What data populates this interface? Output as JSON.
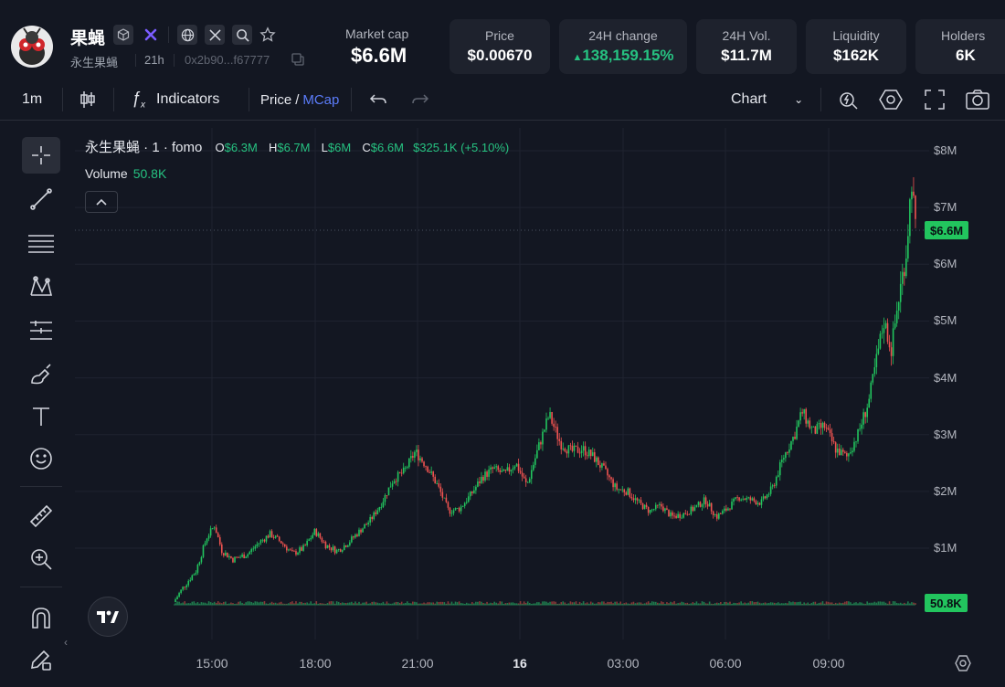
{
  "header": {
    "name": "果蝇",
    "subtitle": "永生果蝇",
    "age": "21h",
    "address": "0x2b90...f67777",
    "market_cap": {
      "label": "Market cap",
      "value": "$6.6M"
    },
    "stats": [
      {
        "label": "Price",
        "value": "$0.00670"
      },
      {
        "label": "24H change",
        "value": "138,159.15%",
        "color": "#26c281"
      },
      {
        "label": "24H Vol.",
        "value": "$11.7M"
      },
      {
        "label": "Liquidity",
        "value": "$162K"
      },
      {
        "label": "Holders",
        "value": "6K"
      }
    ]
  },
  "toolbar": {
    "interval": "1m",
    "indicators": "Indicators",
    "price": "Price",
    "slash": "/",
    "mcap": "MCap",
    "chart": "Chart"
  },
  "legend": {
    "title": "永生果蝇 · 1 · fomo",
    "o_key": "O",
    "o": "$6.3M",
    "h_key": "H",
    "h": "$6.7M",
    "l_key": "L",
    "l": "$6M",
    "c_key": "C",
    "c": "$6.6M",
    "change": "$325.1K (+5.10%)",
    "volume_label": "Volume",
    "volume": "50.8K"
  },
  "colors": {
    "up": "#26a69a",
    "up_bright": "#22c55e",
    "down": "#ef5350",
    "accent": "#5b7cfa"
  },
  "chart_data": {
    "type": "candlestick",
    "y_ticks": [
      "$8M",
      "$7M",
      "$6M",
      "$5M",
      "$4M",
      "$3M",
      "$2M",
      "$1M"
    ],
    "y_values": [
      8,
      7,
      6,
      5,
      4,
      3,
      2,
      1
    ],
    "ylim": [
      0,
      8.4
    ],
    "x_ticks": [
      "15:00",
      "18:00",
      "21:00",
      "16",
      "03:00",
      "06:00",
      "09:00"
    ],
    "last_price_tag": "$6.6M",
    "last_price": 6.6,
    "volume_tag": "50.8K",
    "series": [
      {
        "t": 0,
        "v": 0.05
      },
      {
        "t": 0.3,
        "v": 0.35
      },
      {
        "t": 0.6,
        "v": 0.6
      },
      {
        "t": 0.9,
        "v": 1.2
      },
      {
        "t": 1.1,
        "v": 1.4
      },
      {
        "t": 1.3,
        "v": 0.95
      },
      {
        "t": 1.6,
        "v": 0.8
      },
      {
        "t": 2.0,
        "v": 0.9
      },
      {
        "t": 2.3,
        "v": 1.1
      },
      {
        "t": 2.6,
        "v": 1.25
      },
      {
        "t": 2.9,
        "v": 1.1
      },
      {
        "t": 3.2,
        "v": 0.9
      },
      {
        "t": 3.5,
        "v": 1.0
      },
      {
        "t": 3.8,
        "v": 1.3
      },
      {
        "t": 4.1,
        "v": 1.05
      },
      {
        "t": 4.4,
        "v": 0.95
      },
      {
        "t": 4.7,
        "v": 1.1
      },
      {
        "t": 5.0,
        "v": 1.3
      },
      {
        "t": 5.3,
        "v": 1.5
      },
      {
        "t": 5.6,
        "v": 1.8
      },
      {
        "t": 5.9,
        "v": 2.2
      },
      {
        "t": 6.2,
        "v": 2.35
      },
      {
        "t": 6.5,
        "v": 2.7
      },
      {
        "t": 6.8,
        "v": 2.45
      },
      {
        "t": 7.1,
        "v": 2.1
      },
      {
        "t": 7.4,
        "v": 1.65
      },
      {
        "t": 7.7,
        "v": 1.7
      },
      {
        "t": 8.0,
        "v": 1.95
      },
      {
        "t": 8.3,
        "v": 2.25
      },
      {
        "t": 8.6,
        "v": 2.4
      },
      {
        "t": 8.9,
        "v": 2.3
      },
      {
        "t": 9.2,
        "v": 2.5
      },
      {
        "t": 9.5,
        "v": 2.1
      },
      {
        "t": 9.8,
        "v": 2.75
      },
      {
        "t": 10.1,
        "v": 3.35
      },
      {
        "t": 10.4,
        "v": 2.85
      },
      {
        "t": 10.7,
        "v": 2.7
      },
      {
        "t": 11.0,
        "v": 2.75
      },
      {
        "t": 11.3,
        "v": 2.6
      },
      {
        "t": 11.6,
        "v": 2.35
      },
      {
        "t": 11.9,
        "v": 2.05
      },
      {
        "t": 12.2,
        "v": 2.0
      },
      {
        "t": 12.5,
        "v": 1.8
      },
      {
        "t": 12.8,
        "v": 1.65
      },
      {
        "t": 13.1,
        "v": 1.75
      },
      {
        "t": 13.4,
        "v": 1.55
      },
      {
        "t": 13.7,
        "v": 1.6
      },
      {
        "t": 14.0,
        "v": 1.7
      },
      {
        "t": 14.3,
        "v": 1.85
      },
      {
        "t": 14.6,
        "v": 1.55
      },
      {
        "t": 14.9,
        "v": 1.7
      },
      {
        "t": 15.2,
        "v": 1.9
      },
      {
        "t": 15.5,
        "v": 1.85
      },
      {
        "t": 15.8,
        "v": 1.8
      },
      {
        "t": 16.1,
        "v": 2.05
      },
      {
        "t": 16.4,
        "v": 2.6
      },
      {
        "t": 16.7,
        "v": 3.0
      },
      {
        "t": 16.9,
        "v": 3.4
      },
      {
        "t": 17.2,
        "v": 3.05
      },
      {
        "t": 17.5,
        "v": 3.15
      },
      {
        "t": 17.8,
        "v": 2.75
      },
      {
        "t": 18.1,
        "v": 2.6
      },
      {
        "t": 18.4,
        "v": 3.0
      },
      {
        "t": 18.7,
        "v": 3.6
      },
      {
        "t": 18.9,
        "v": 4.3
      },
      {
        "t": 19.1,
        "v": 5.0
      },
      {
        "t": 19.3,
        "v": 4.5
      },
      {
        "t": 19.5,
        "v": 5.4
      },
      {
        "t": 19.7,
        "v": 6.2
      },
      {
        "t": 19.85,
        "v": 7.5
      },
      {
        "t": 19.95,
        "v": 6.6
      }
    ]
  }
}
